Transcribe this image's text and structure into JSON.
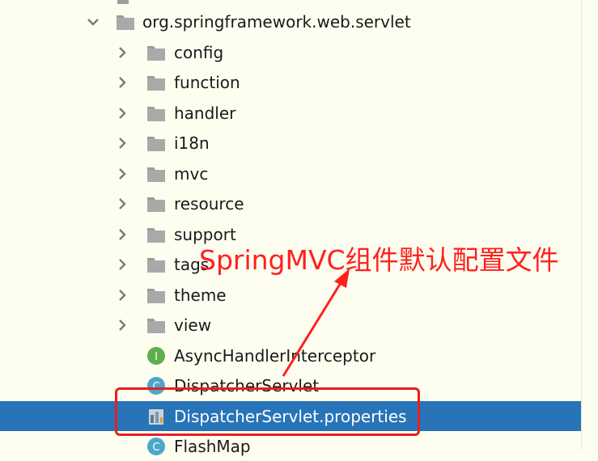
{
  "tree": {
    "root": {
      "label": "org.springframework.web.servlet",
      "icon": "package-icon",
      "expanded": true
    },
    "folders": [
      {
        "label": "config",
        "icon": "package-icon"
      },
      {
        "label": "function",
        "icon": "package-icon"
      },
      {
        "label": "handler",
        "icon": "package-icon"
      },
      {
        "label": "i18n",
        "icon": "package-icon"
      },
      {
        "label": "mvc",
        "icon": "package-icon"
      },
      {
        "label": "resource",
        "icon": "package-icon"
      },
      {
        "label": "support",
        "icon": "package-icon"
      },
      {
        "label": "tags",
        "icon": "package-icon"
      },
      {
        "label": "theme",
        "icon": "package-icon"
      },
      {
        "label": "view",
        "icon": "package-icon"
      }
    ],
    "files": [
      {
        "label": "AsyncHandlerInterceptor",
        "icon": "interface-icon",
        "glyph": "I"
      },
      {
        "label": "DispatcherServlet",
        "icon": "class-icon",
        "glyph": "C"
      },
      {
        "label": "DispatcherServlet.properties",
        "icon": "properties-file-icon",
        "selected": true
      },
      {
        "label": "FlashMap",
        "icon": "class-icon",
        "glyph": "C"
      }
    ]
  },
  "annotation": {
    "text": "SpringMVC组件默认配置文件",
    "color": "#ff2020"
  },
  "colors": {
    "selection": "#2874b8",
    "background": "#fefef0",
    "highlight_box": "#e6201f",
    "interface_icon": "#5fae4e",
    "class_icon": "#4aa8c9"
  }
}
